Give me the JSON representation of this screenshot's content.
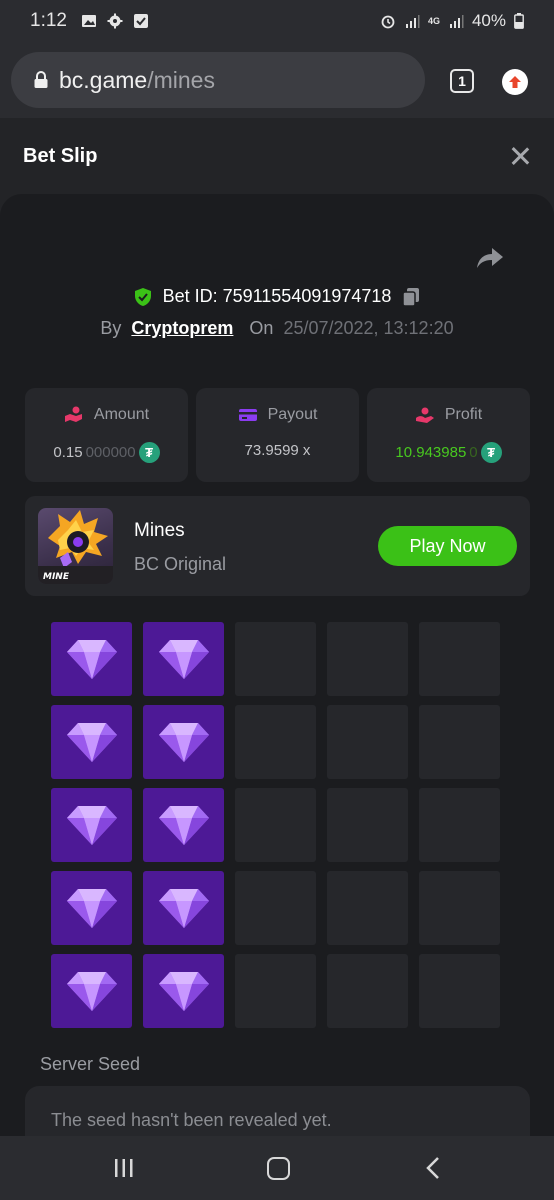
{
  "status_bar": {
    "time": "1:12",
    "network_labels": [
      "4G"
    ],
    "battery": "40%"
  },
  "browser": {
    "url_domain": "bc.game",
    "url_path": "/mines",
    "tab_count": "1"
  },
  "bet_slip": {
    "title": "Bet Slip",
    "bet_id_label": "Bet ID: 75911554091974718",
    "by_label": "By",
    "username": "Cryptoprem",
    "on_label": "On",
    "date": "25/07/2022, 13:12:20"
  },
  "stats": {
    "amount_label": "Amount",
    "amount_value_main": "0.15",
    "amount_value_dim": "000000",
    "payout_label": "Payout",
    "payout_value": "73.9599 x",
    "profit_label": "Profit",
    "profit_value_main": "10.943985",
    "profit_value_dim": "0",
    "currency_icon": "tether-icon"
  },
  "game": {
    "name": "Mines",
    "provider": "BC Original",
    "thumb_label": "MINE",
    "play_label": "Play Now"
  },
  "mines_grid": {
    "columns": 5,
    "rows": 5,
    "cells": [
      "gem",
      "gem",
      "hidden",
      "hidden",
      "hidden",
      "gem",
      "gem",
      "hidden",
      "hidden",
      "hidden",
      "gem",
      "gem",
      "hidden",
      "hidden",
      "hidden",
      "gem",
      "gem",
      "hidden",
      "hidden",
      "hidden",
      "gem",
      "gem",
      "hidden",
      "hidden",
      "hidden"
    ]
  },
  "seed": {
    "label": "Server Seed",
    "placeholder": "The seed hasn't been revealed yet."
  },
  "colors": {
    "accent_green": "#3bc117",
    "profit_green": "#48c91f",
    "gem_tile": "#4d1996",
    "tether": "#26a17b"
  }
}
